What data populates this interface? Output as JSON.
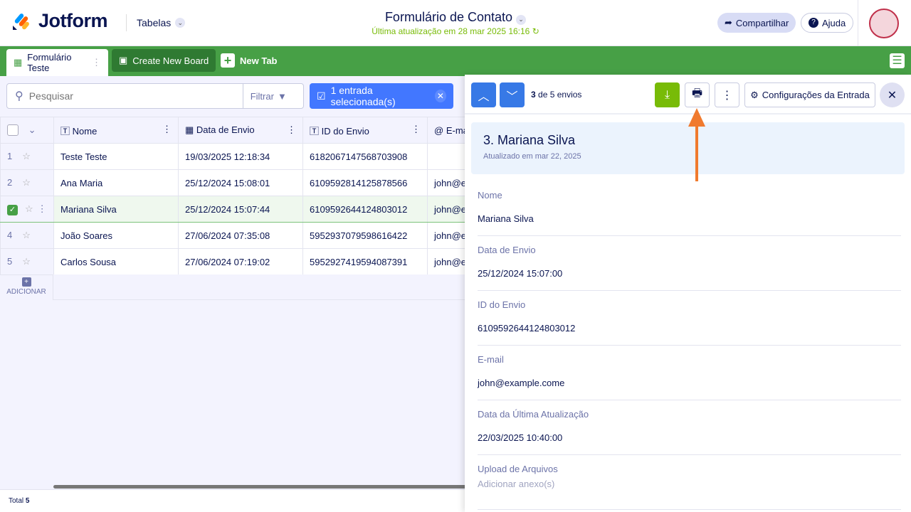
{
  "header": {
    "brand": "Jotform",
    "section": "Tabelas",
    "title": "Formulário de Contato",
    "updated": "Última atualização em 28 mar 2025 16:16",
    "share": "Compartilhar",
    "help": "Ajuda"
  },
  "tabs": {
    "active": "Formulário Teste",
    "create_board": "Create New Board",
    "new_tab": "New Tab"
  },
  "toolbar": {
    "search_placeholder": "Pesquisar",
    "filter": "Filtrar",
    "selected": "1 entrada selecionada(s)"
  },
  "table": {
    "columns": [
      "Nome",
      "Data de Envio",
      "ID do Envio",
      "E-mail"
    ],
    "rows": [
      {
        "n": "1",
        "nome": "Teste Teste",
        "data": "19/03/2025 12:18:34",
        "id": "6182067147568703908",
        "email": ""
      },
      {
        "n": "2",
        "nome": "Ana Maria",
        "data": "25/12/2024 15:08:01",
        "id": "6109592814125878566",
        "email": "john@ex"
      },
      {
        "n": "3",
        "nome": "Mariana Silva",
        "data": "25/12/2024 15:07:44",
        "id": "6109592644124803012",
        "email": "john@ex"
      },
      {
        "n": "4",
        "nome": "João Soares",
        "data": "27/06/2024 07:35:08",
        "id": "5952937079598616422",
        "email": "john@ex"
      },
      {
        "n": "5",
        "nome": "Carlos Sousa",
        "data": "27/06/2024 07:19:02",
        "id": "5952927419594087391",
        "email": "john@ex"
      }
    ],
    "add": "ADICIONAR",
    "total_label": "Total",
    "total": "5"
  },
  "panel": {
    "current": "3",
    "counter": "de 5 envios",
    "settings": "Configurações da Entrada",
    "title": "3. Mariana Silva",
    "subtitle": "Atualizado em mar 22, 2025",
    "fields": [
      {
        "label": "Nome",
        "value": "Mariana Silva"
      },
      {
        "label": "Data de Envio",
        "value": "25/12/2024 15:07:00"
      },
      {
        "label": "ID do Envio",
        "value": "6109592644124803012"
      },
      {
        "label": "E-mail",
        "value": "john@example.come"
      },
      {
        "label": "Data da Última Atualização",
        "value": "22/03/2025 10:40:00"
      },
      {
        "label": "Upload de Arquivos",
        "value": "Adicionar anexo(s)"
      }
    ]
  }
}
